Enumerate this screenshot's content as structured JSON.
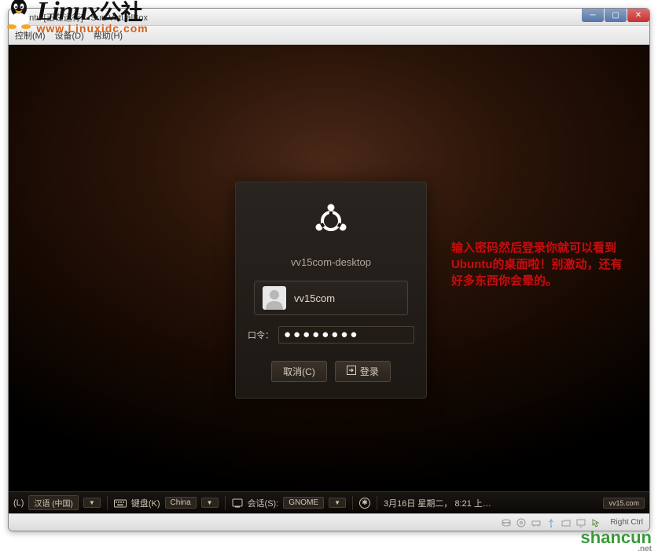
{
  "window": {
    "title": "Ubuntu [正在运行] - Sun VirtualBox",
    "min_icon": "minimize",
    "max_icon": "maximize",
    "close_icon": "close"
  },
  "menubar": {
    "items": [
      "控制(M)",
      "设备(D)",
      "帮助(H)"
    ]
  },
  "watermark": {
    "title_en": "Linux",
    "title_cn": "公社",
    "url": "www.Linuxidc.com"
  },
  "login": {
    "hostname": "vv15com-desktop",
    "username": "vv15com",
    "password_label": "口令：",
    "password_mask": "●●●●●●●●",
    "cancel_label": "取消(C)",
    "login_label": "登录"
  },
  "annotation": {
    "text": "输入密码然后登录你就可以看到Ubuntu的桌面啦！别激动，还有好多东西你会晕的。"
  },
  "panel": {
    "lang_label": "(L)",
    "language": "汉语 (中国)",
    "keyboard_label": "键盘(K)",
    "keyboard_value": "China",
    "session_label": "会话(S):",
    "session_value": "GNOME",
    "datetime": "3月16日 星期二， 8:21 上…",
    "brand_badge": "vv15.com"
  },
  "statusbar": {
    "host_key": "Right Ctrl"
  },
  "shancun": {
    "main": "shancun",
    "sub": ".net"
  }
}
